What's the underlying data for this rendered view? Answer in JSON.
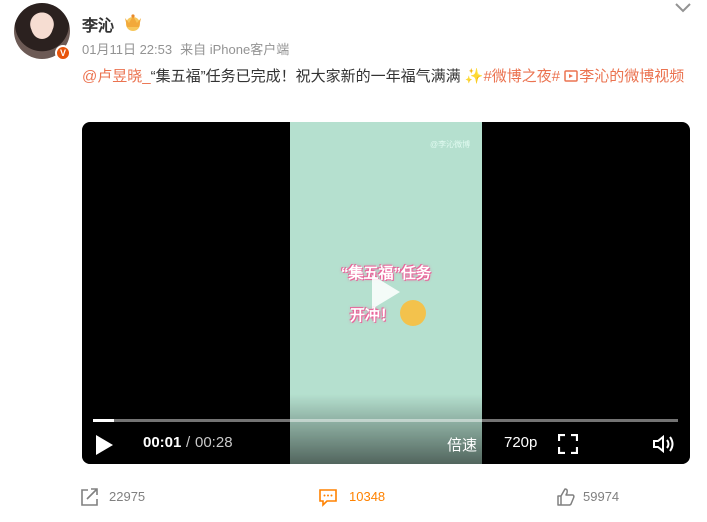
{
  "author": {
    "name": "李沁",
    "verified_badge_text": "V"
  },
  "post": {
    "date": "01月11日 22:53",
    "source": "来自 iPhone客户端",
    "mention": "@卢昱晓_",
    "text_part1": "“集五福”任务已完成！祝大家新的一年福气满满",
    "sparkle": "✨",
    "topic": "#微博之夜#",
    "video_link": "李沁的微博视频"
  },
  "video": {
    "frame_watermark": "@李沁微博",
    "frame_line1": "“集五福”任务",
    "frame_line2": "开冲！",
    "progress_fraction": 0.036,
    "current_time": "00:01",
    "separator": "/",
    "duration": "00:28",
    "speed_label": "倍速",
    "quality_label": "720p"
  },
  "footer": {
    "shares": "22975",
    "comments": "10348",
    "likes": "59974"
  },
  "icons": {
    "crown": "crown-icon",
    "more": "chevron-down-icon",
    "play": "play-icon",
    "fullscreen": "fullscreen-icon",
    "volume": "volume-icon",
    "share": "share-icon",
    "comment": "comment-icon",
    "like": "thumbs-up-icon"
  },
  "colors": {
    "accent": "#eb7350",
    "comment_active": "#ff8200",
    "video_frame_bg": "#b5e0cf"
  }
}
